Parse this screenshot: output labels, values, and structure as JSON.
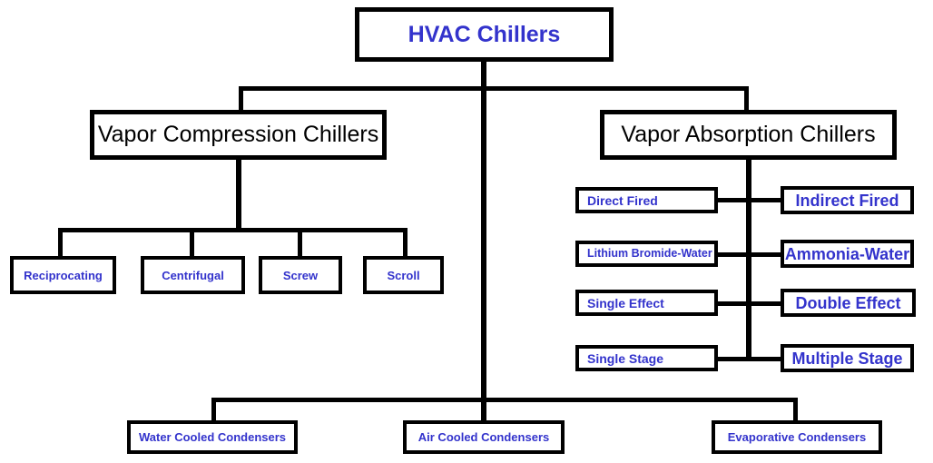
{
  "diagram": {
    "title": "HVAC Chillers",
    "colors": {
      "accent_blue": "#3333cc",
      "line_black": "#000000",
      "background": "#ffffff"
    },
    "root": {
      "label": "HVAC Chillers"
    },
    "branches": {
      "vapor_compression": {
        "label": "Vapor Compression Chillers",
        "children": [
          {
            "label": "Reciprocating"
          },
          {
            "label": "Centrifugal"
          },
          {
            "label": "Screw"
          },
          {
            "label": "Scroll"
          }
        ]
      },
      "vapor_absorption": {
        "label": "Vapor Absorption Chillers",
        "pairs": [
          {
            "left": "Direct Fired",
            "right": "Indirect Fired"
          },
          {
            "left": "Lithium Bromide-Water",
            "right": "Ammonia-Water"
          },
          {
            "left": "Single Effect",
            "right": "Double Effect"
          },
          {
            "left": "Single Stage",
            "right": "Multiple Stage"
          }
        ]
      }
    },
    "condensers": [
      {
        "label": "Water Cooled Condensers"
      },
      {
        "label": "Air Cooled Condensers"
      },
      {
        "label": "Evaporative Condensers"
      }
    ]
  }
}
